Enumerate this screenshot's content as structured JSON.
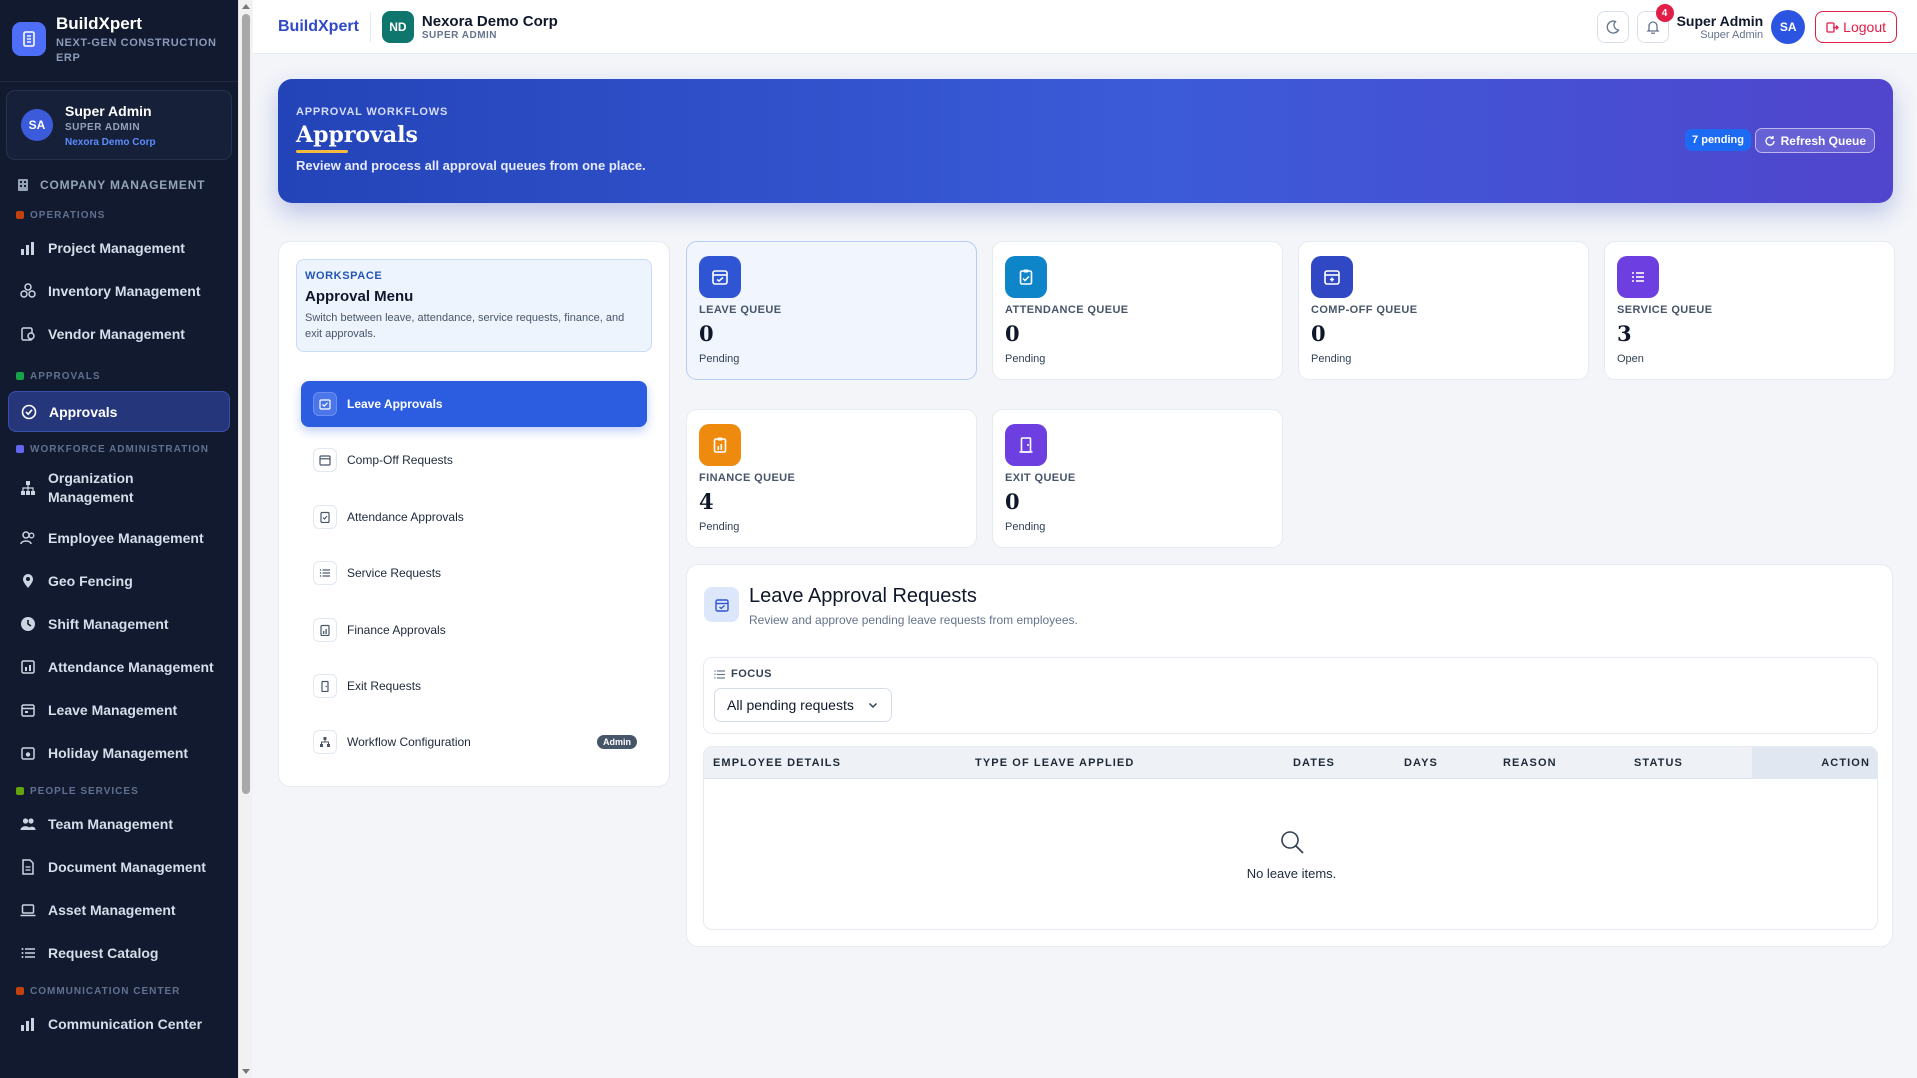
{
  "sidebar": {
    "brand_name": "BuildXpert",
    "brand_sub": "NEXT-GEN CONSTRUCTION ERP",
    "user": {
      "initials": "SA",
      "name": "Super Admin",
      "role": "SUPER ADMIN",
      "company": "Nexora Demo Corp"
    },
    "company_management": "COMPANY MANAGEMENT",
    "sections": {
      "operations": "OPERATIONS",
      "approvals": "APPROVALS",
      "workforce": "WORKFORCE ADMINISTRATION",
      "people": "PEOPLE SERVICES",
      "communication": "COMMUNICATION CENTER"
    },
    "items": {
      "project": "Project Management",
      "inventory": "Inventory Management",
      "vendor": "Vendor Management",
      "approvals": "Approvals",
      "organization": "Organization Management",
      "employee": "Employee Management",
      "geo": "Geo Fencing",
      "shift": "Shift Management",
      "attendance": "Attendance Management",
      "leave": "Leave Management",
      "holiday": "Holiday Management",
      "team": "Team Management",
      "document": "Document Management",
      "asset": "Asset Management",
      "request_catalog": "Request Catalog",
      "communication": "Communication Center"
    }
  },
  "topbar": {
    "brand": "BuildXpert",
    "org_initials": "ND",
    "org_name": "Nexora Demo Corp",
    "org_role": "SUPER ADMIN",
    "notification_count": "4",
    "user_name": "Super Admin",
    "user_role": "Super Admin",
    "user_initials": "SA",
    "logout": "Logout"
  },
  "hero": {
    "kicker": "APPROVAL WORKFLOWS",
    "title": "Approvals",
    "description": "Review and process all approval queues from one place.",
    "pending_badge": "7 pending",
    "refresh": "Refresh Queue"
  },
  "menu": {
    "kicker": "WORKSPACE",
    "title": "Approval Menu",
    "description": "Switch between leave, attendance, service requests, finance, and exit approvals.",
    "items": [
      {
        "label": "Leave Approvals",
        "icon": "calendar-check-icon"
      },
      {
        "label": "Comp-Off Requests",
        "icon": "calendar-plus-icon"
      },
      {
        "label": "Attendance Approvals",
        "icon": "clipboard-check-icon"
      },
      {
        "label": "Service Requests",
        "icon": "list-icon"
      },
      {
        "label": "Finance Approvals",
        "icon": "finance-report-icon"
      },
      {
        "label": "Exit Requests",
        "icon": "door-exit-icon"
      },
      {
        "label": "Workflow Configuration",
        "icon": "hierarchy-icon",
        "tag": "Admin"
      }
    ]
  },
  "queues": [
    {
      "label": "LEAVE QUEUE",
      "value": "0",
      "sub": "Pending",
      "color": "#2f55d4"
    },
    {
      "label": "ATTENDANCE QUEUE",
      "value": "0",
      "sub": "Pending",
      "color": "#0e84c9"
    },
    {
      "label": "COMP-OFF QUEUE",
      "value": "0",
      "sub": "Pending",
      "color": "#3048c4"
    },
    {
      "label": "SERVICE QUEUE",
      "value": "3",
      "sub": "Open",
      "color": "#6d3fe0"
    },
    {
      "label": "FINANCE QUEUE",
      "value": "4",
      "sub": "Pending",
      "color": "#ee8a0e"
    },
    {
      "label": "EXIT QUEUE",
      "value": "0",
      "sub": "Pending",
      "color": "#6d3fe0"
    }
  ],
  "requests": {
    "title": "Leave Approval Requests",
    "description": "Review and approve pending leave requests from employees.",
    "focus_label": "FOCUS",
    "focus_value": "All pending requests",
    "columns": [
      "EMPLOYEE DETAILS",
      "TYPE OF LEAVE APPLIED",
      "DATES",
      "DAYS",
      "REASON",
      "STATUS",
      "ACTION"
    ],
    "empty_text": "No leave items."
  }
}
